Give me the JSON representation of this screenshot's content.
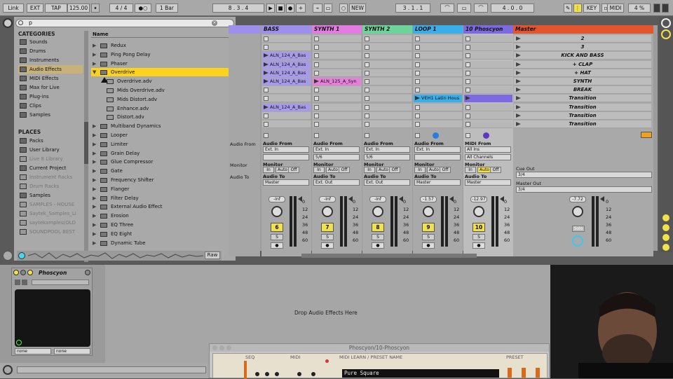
{
  "transport": {
    "link": "Link",
    "ext": "EXT",
    "tap": "TAP",
    "tempo": "125.00",
    "sig": "4 / 4",
    "metro": "●○",
    "quant": "1 Bar",
    "position": "8 .   3 .   4",
    "new": "NEW",
    "loop_start": "3 .   1 .   1",
    "loop_len": "4 .   0 .   0",
    "key": "KEY",
    "midi": "MIDI",
    "cpu": "4 %"
  },
  "browser": {
    "search": "p",
    "categories_title": "CATEGORIES",
    "categories": [
      {
        "label": "Sounds",
        "icon": "speaker-icon"
      },
      {
        "label": "Drums",
        "icon": "drum-icon"
      },
      {
        "label": "Instruments",
        "icon": "keyboard-icon"
      },
      {
        "label": "Audio Effects",
        "icon": "audio-effects-icon"
      },
      {
        "label": "MIDI Effects",
        "icon": "midi-icon"
      },
      {
        "label": "Max for Live",
        "icon": "max-icon"
      },
      {
        "label": "Plug-ins",
        "icon": "plugin-icon"
      },
      {
        "label": "Clips",
        "icon": "clip-icon"
      },
      {
        "label": "Samples",
        "icon": "wave-icon"
      }
    ],
    "places_title": "PLACES",
    "places": [
      "Packs",
      "User Library",
      "Live 8 Library",
      "Current Project",
      "Instrument Racks",
      "Drum Racks",
      "Samples",
      "SAMPLES - HOUSE",
      "Saytek_Samples_Li",
      "saytekamples(OLD",
      "SOUNDPOOL BEST"
    ],
    "name_header": "Name",
    "files": [
      {
        "name": "Redux",
        "type": "folder"
      },
      {
        "name": "Ping Pong Delay",
        "type": "folder"
      },
      {
        "name": "Phaser",
        "type": "folder"
      },
      {
        "name": "Overdrive",
        "type": "open"
      },
      {
        "name": "Overdrive.adv",
        "type": "file"
      },
      {
        "name": "Mids Overdrive.adv",
        "type": "file"
      },
      {
        "name": "Mids Distort.adv",
        "type": "file"
      },
      {
        "name": "Enhance.adv",
        "type": "file"
      },
      {
        "name": "Distort.adv",
        "type": "file"
      },
      {
        "name": "Multiband Dynamics",
        "type": "folder"
      },
      {
        "name": "Looper",
        "type": "folder"
      },
      {
        "name": "Limiter",
        "type": "folder"
      },
      {
        "name": "Grain Delay",
        "type": "folder"
      },
      {
        "name": "Glue Compressor",
        "type": "folder"
      },
      {
        "name": "Gate",
        "type": "folder"
      },
      {
        "name": "Frequency Shifter",
        "type": "folder"
      },
      {
        "name": "Flanger",
        "type": "folder"
      },
      {
        "name": "Filter Delay",
        "type": "folder"
      },
      {
        "name": "External Audio Effect",
        "type": "folder"
      },
      {
        "name": "Erosion",
        "type": "folder"
      },
      {
        "name": "EQ Three",
        "type": "folder"
      },
      {
        "name": "EQ Eight",
        "type": "folder"
      },
      {
        "name": "Dynamic Tube",
        "type": "folder"
      }
    ],
    "raw": "Raw"
  },
  "tracks": [
    {
      "name": "BASS",
      "color": "#9e8fea",
      "clips": {
        "2": "ALN_124_A_Bas",
        "3": "ALN_124_A_Bas",
        "4": "ALN_124_A_Bas",
        "5": "ALN_124_A_Bas",
        "8": "ALN_124_A_Bas"
      },
      "clip_color": "#a79ae8",
      "audio_from": "Audio From",
      "from_value": "Ext. In",
      "monitor": "Monitor",
      "audio_to": "Audio To",
      "to_value": "Master",
      "sub": "",
      "vol": "-Inf",
      "num": "6"
    },
    {
      "name": "SYNTH 1",
      "color": "#e27ce0",
      "clips": {
        "5": "ALN_125_A_Syn"
      },
      "clip_color": "#e57fd8",
      "audio_from": "Audio From",
      "from_value": "Ext. In",
      "monitor": "Monitor",
      "audio_to": "Audio To",
      "to_value": "Ext. Out",
      "sub": "5/6",
      "vol": "-Inf",
      "num": "7"
    },
    {
      "name": "SYNTH 2",
      "color": "#6ed39a",
      "clips": {},
      "clip_color": "#6ed39a",
      "audio_from": "Audio From",
      "from_value": "Ext. In",
      "monitor": "Monitor",
      "audio_to": "Audio To",
      "to_value": "Ext. Out",
      "sub": "5/6",
      "vol": "-Inf",
      "num": "8"
    },
    {
      "name": "LOOP 1",
      "color": "#3aaee8",
      "clips": {
        "7": "VEH1 Latin Hous"
      },
      "clip_color": "#3aaee8",
      "audio_from": "Audio From",
      "from_value": "Ext. In",
      "monitor": "Monitor",
      "audio_to": "Audio To",
      "to_value": "Master",
      "sub": "",
      "vol": "-1.57",
      "num": "9"
    },
    {
      "name": "10 Phoscyon",
      "color": "#7d6ae0",
      "clips": {
        "7": ""
      },
      "clip_color": "#7d6ae0",
      "audio_from": "MIDI From",
      "from_value": "All Ins",
      "monitor": "Monitor",
      "audio_to": "Audio To",
      "to_value": "Master",
      "sub": "All Channels",
      "vol": "-12.97",
      "num": "10"
    }
  ],
  "master": {
    "name": "Master",
    "color": "#e2552e",
    "scenes": [
      "2",
      "3",
      "KICK AND BASS",
      "+ CLAP",
      "+ HAT",
      "SYNTH",
      "BREAK",
      "Transition",
      "Transition",
      "Transition",
      "Transition"
    ],
    "cue_out": "Cue Out",
    "cue_val": "3/4",
    "master_out": "Master Out",
    "master_val": "3/4",
    "vol": "-7.72",
    "solo": "Solo"
  },
  "monitor_buttons": [
    "In",
    "Auto",
    "Off"
  ],
  "scale": [
    "0",
    "12",
    "24",
    "36",
    "48",
    "60"
  ],
  "partial_track": {
    "audio_from": "Audio From",
    "monitor": "Monitor",
    "audio_to": "Audio To"
  },
  "detail": {
    "device_name": "Phoscyon",
    "drop_text": "Drop Audio Effects Here",
    "none1": "none",
    "none2": "none"
  },
  "plugin": {
    "title": "Phoscyon/10-Phoscyon",
    "seq": "SEQ",
    "midi": "MIDI",
    "midi_learn": "MIDI LEARN / PRESET NAME",
    "preset_name": "Pure Square",
    "preset": "PRESET"
  }
}
